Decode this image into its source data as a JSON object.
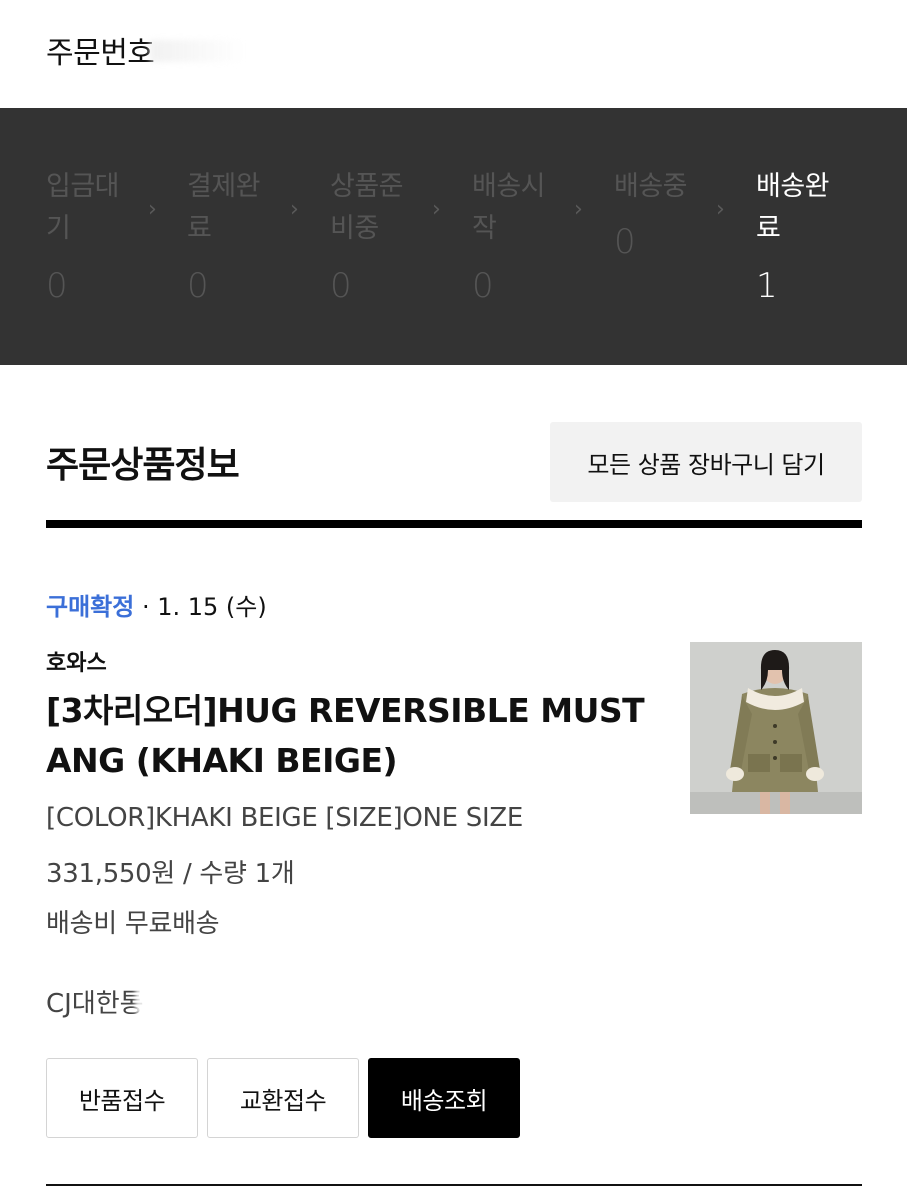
{
  "header": {
    "order_number_label": "주문번호"
  },
  "order_status": {
    "steps": [
      {
        "label": "입금대기",
        "count": "0"
      },
      {
        "label": "결제완료",
        "count": "0"
      },
      {
        "label": "상품준비중",
        "count": "0"
      },
      {
        "label": "배송시작",
        "count": "0"
      },
      {
        "label": "배송중",
        "count": "0"
      },
      {
        "label": "배송완료",
        "count": "1"
      }
    ],
    "active_index": 5
  },
  "order_items": {
    "title": "주문상품정보",
    "cart_all_label": "모든 상품 장바구니 담기",
    "item": {
      "status": "구매확정",
      "date": " · 1. 15 (수)",
      "brand": "호와스",
      "name": "[3차리오더]HUG REVERSIBLE MUSTANG (KHAKI BEIGE)",
      "option": "[COLOR]KHAKI BEIGE [SIZE]ONE SIZE",
      "price_qty": "331,550원 / 수량 1개",
      "shipping": "배송비 무료배송",
      "courier": "CJ대한통"
    },
    "actions": {
      "return_label": "반품접수",
      "exchange_label": "교환접수",
      "track_label": "배송조회"
    }
  },
  "colors": {
    "status_panel_bg": "#333333",
    "inactive_step": "#555555",
    "active_step": "#ffffff",
    "confirm_blue": "#3b6fd8",
    "primary_button": "#000000"
  }
}
